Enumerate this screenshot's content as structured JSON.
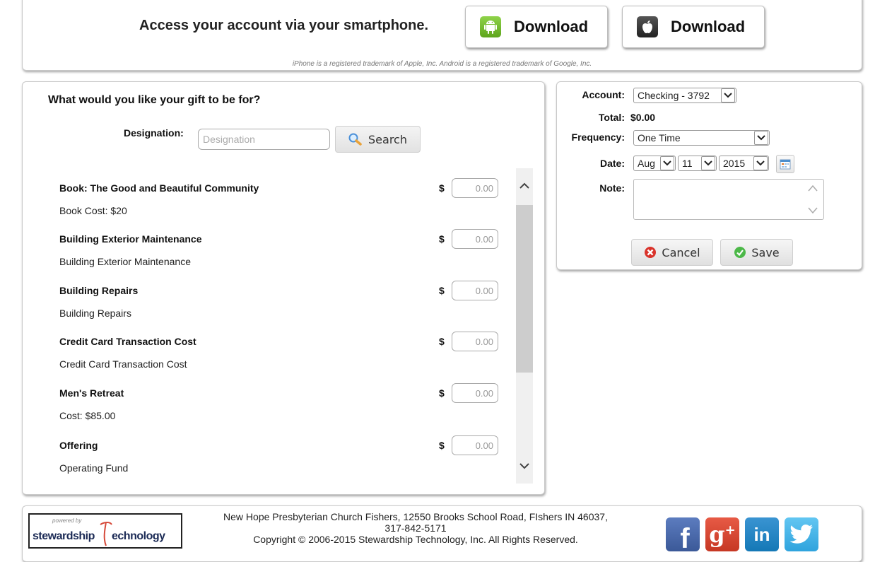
{
  "app_promo": {
    "heading": "Access your account via your smartphone.",
    "android_download_label": "Download",
    "apple_download_label": "Download",
    "trademark_notice": "iPhone is a registered trademark of Apple, Inc.  Android is a registered trademark of Google, Inc."
  },
  "designation_panel": {
    "heading": "What would you like your gift to be for?",
    "designation_label": "Designation:",
    "designation_placeholder": "Designation",
    "designation_value": "",
    "search_label": "Search",
    "currency_symbol": "$",
    "amount_placeholder": "0.00",
    "funds": [
      {
        "name": "Book: The Good and Beautiful Community",
        "description": "Book Cost: $20"
      },
      {
        "name": "Building Exterior Maintenance",
        "description": "Building Exterior Maintenance"
      },
      {
        "name": "Building Repairs",
        "description": "Building Repairs"
      },
      {
        "name": "Credit Card Transaction Cost",
        "description": "Credit Card Transaction Cost"
      },
      {
        "name": "Men's Retreat",
        "description": "Cost: $85.00"
      },
      {
        "name": "Offering",
        "description": "Operating Fund"
      }
    ]
  },
  "gift_form": {
    "account_label": "Account:",
    "account_value": "Checking - 3792",
    "total_label": "Total:",
    "total_value": "$0.00",
    "frequency_label": "Frequency:",
    "frequency_value": "One Time",
    "date_label": "Date:",
    "date_month": "Aug",
    "date_day": "11",
    "date_year": "2015",
    "note_label": "Note:",
    "note_value": "",
    "cancel_label": "Cancel",
    "save_label": "Save"
  },
  "footer": {
    "logo_small_text": "powered by",
    "logo_text_left": "stewardship",
    "logo_text_right": "echnology",
    "address_line": "New Hope Presbyterian Church Fishers, 12550 Brooks School Road, FIshers IN 46037,",
    "phone_line": "317-842-5171",
    "copyright_line": "Copyright © 2006-2015 Stewardship Technology, Inc. All Rights Reserved."
  },
  "colors": {
    "android_green": "#78c232",
    "cancel_red": "#d9332b",
    "save_green": "#4cb848",
    "facebook": "#3b5998",
    "google_plus": "#d34836",
    "linkedin": "#1478b6",
    "twitter": "#2fa3dd"
  },
  "icons": {
    "android": "android-icon",
    "apple": "apple-icon",
    "search": "magnifier-icon",
    "calendar": "calendar-icon",
    "cancel": "x-circle-icon",
    "save": "check-circle-icon",
    "social": [
      "facebook-icon",
      "google-plus-icon",
      "linkedin-icon",
      "twitter-icon"
    ]
  }
}
